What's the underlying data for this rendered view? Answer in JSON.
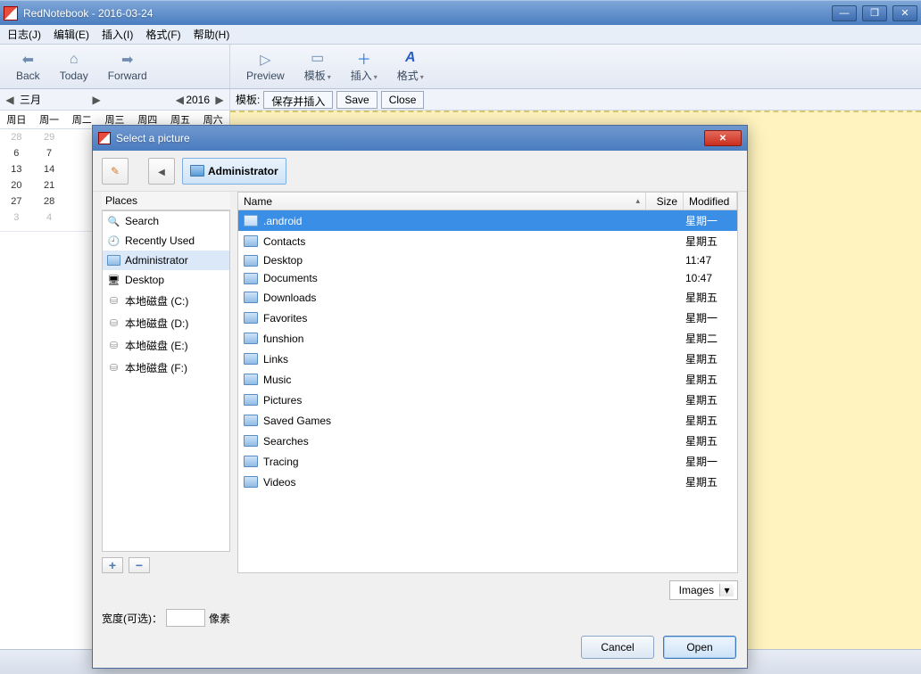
{
  "window": {
    "title": "RedNotebook - 2016-03-24"
  },
  "menu": {
    "journal": "日志(J)",
    "edit": "编辑(E)",
    "insert": "插入(I)",
    "format": "格式(F)",
    "help": "帮助(H)"
  },
  "toolbar_left": {
    "back": "Back",
    "today": "Today",
    "forward": "Forward"
  },
  "toolbar_right": {
    "preview": "Preview",
    "template": "模板",
    "insert": "插入",
    "format": "格式"
  },
  "calbar": {
    "month": "三月",
    "year": "2016"
  },
  "template_bar": {
    "label": "模板:",
    "save_insert": "保存并插入",
    "save": "Save",
    "close": "Close"
  },
  "calendar": {
    "days": [
      "周日",
      "周一",
      "周二",
      "周三",
      "周四",
      "周五",
      "周六"
    ],
    "rows": [
      [
        "28",
        "29",
        "",
        "",
        "",
        "",
        ""
      ],
      [
        "6",
        "7",
        "",
        "",
        "",
        "",
        ""
      ],
      [
        "13",
        "14",
        "",
        "",
        "",
        "",
        ""
      ],
      [
        "20",
        "21",
        "",
        "",
        "",
        "",
        ""
      ],
      [
        "27",
        "28",
        "",
        "",
        "",
        "",
        ""
      ],
      [
        "3",
        "4",
        "",
        "",
        "",
        "",
        ""
      ]
    ],
    "grey_rows": [
      0,
      5
    ]
  },
  "dialog": {
    "title": "Select a picture",
    "path_current": "Administrator",
    "places_header": "Places",
    "places": [
      {
        "label": "Search",
        "icon": "search"
      },
      {
        "label": "Recently Used",
        "icon": "recent"
      },
      {
        "label": "Administrator",
        "icon": "folder",
        "selected": true
      },
      {
        "label": "Desktop",
        "icon": "desktop"
      },
      {
        "label": "本地磁盘 (C:)",
        "icon": "drive"
      },
      {
        "label": "本地磁盘 (D:)",
        "icon": "drive"
      },
      {
        "label": "本地磁盘 (E:)",
        "icon": "drive"
      },
      {
        "label": "本地磁盘 (F:)",
        "icon": "drive"
      }
    ],
    "columns": {
      "name": "Name",
      "size": "Size",
      "modified": "Modified"
    },
    "files": [
      {
        "name": ".android",
        "modified": "星期一",
        "selected": true
      },
      {
        "name": "Contacts",
        "modified": "星期五"
      },
      {
        "name": "Desktop",
        "modified": "11:47"
      },
      {
        "name": "Documents",
        "modified": "10:47"
      },
      {
        "name": "Downloads",
        "modified": "星期五"
      },
      {
        "name": "Favorites",
        "modified": "星期一"
      },
      {
        "name": "funshion",
        "modified": "星期二"
      },
      {
        "name": "Links",
        "modified": "星期五"
      },
      {
        "name": "Music",
        "modified": "星期五"
      },
      {
        "name": "Pictures",
        "modified": "星期五"
      },
      {
        "name": "Saved Games",
        "modified": "星期五"
      },
      {
        "name": "Searches",
        "modified": "星期五"
      },
      {
        "name": "Tracing",
        "modified": "星期一"
      },
      {
        "name": "Videos",
        "modified": "星期五"
      }
    ],
    "filter": "Images",
    "width_label": "宽度(可选)：",
    "width_unit": "像素",
    "cancel": "Cancel",
    "open": "Open"
  }
}
